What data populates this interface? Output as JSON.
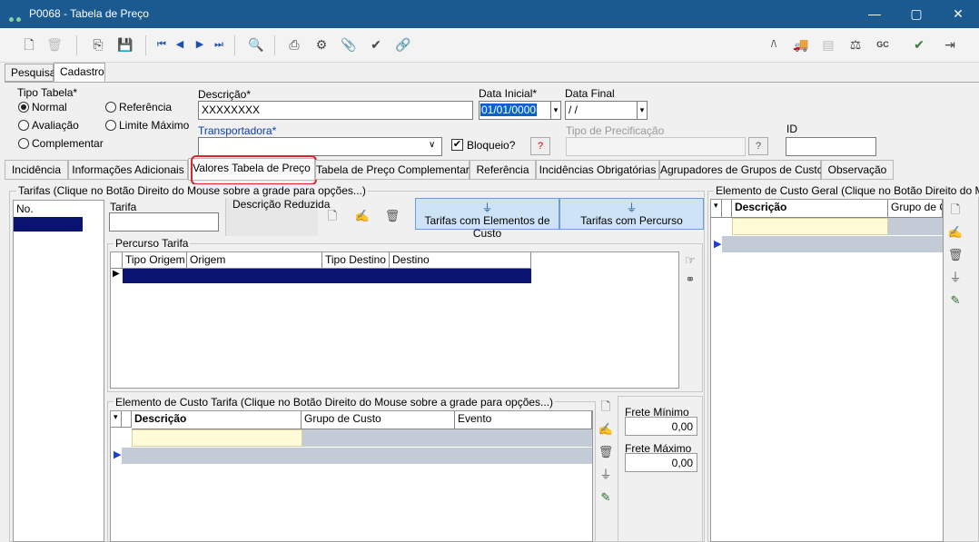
{
  "window": {
    "title": "P0068 - Tabela de Preço",
    "minimize": "—",
    "maximize": "▢",
    "close": "✕"
  },
  "toolbar": {
    "new": "🗋",
    "delete": "🗑",
    "copy": "⎘",
    "save": "💾",
    "first": "⏮",
    "prev": "◀",
    "next": "▶",
    "last": "⏭",
    "find": "🔍",
    "print": "⎙",
    "settings": "⚙",
    "attach": "📎",
    "confirm": "✔",
    "link": "🔗",
    "r1": "/\\",
    "r2": "🚚",
    "r3": "▤",
    "r4": "⚖",
    "r5": "GC",
    "r6": "✔",
    "r7": "⇥"
  },
  "tabs": {
    "pesquisa": "Pesquisa",
    "cadastro": "Cadastro"
  },
  "header": {
    "tipo_tabela_label": "Tipo Tabela*",
    "radio_normal": "Normal",
    "radio_avaliacao": "Avaliação",
    "radio_complementar": "Complementar",
    "radio_referencia": "Referência",
    "radio_limite": "Limite Máximo",
    "descricao_label": "Descrição*",
    "descricao_value": "XXXXXXXX",
    "data_inicial_label": "Data Inicial*",
    "data_inicial_value": "01/01/0000",
    "data_final_label": "Data Final",
    "data_final_value": " / /",
    "transportadora_label": "Transportadora*",
    "transportadora_value": "",
    "bloqueio_label": "Bloqueio?",
    "bloqueio_checked": "✔",
    "help": "?",
    "tipo_precificacao_label": "Tipo de Precificação",
    "id_label": "ID",
    "id_value": ""
  },
  "subtabs": [
    "Incidência",
    "Informações Adicionais",
    "Valores Tabela de Preço",
    "Tabela de Preço Complementar",
    "Referência",
    "Incidências Obrigatórias",
    "Agrupadores de Grupos de Custo",
    "Observação"
  ],
  "tarifas": {
    "group_label": "Tarifas    (Clique no Botão Direito do Mouse sobre a grade para opções...)",
    "col_no": "No.",
    "tarifa_label": "Tarifa",
    "tarifa_value": "",
    "desc_reduzida_label": "Descrição Reduzida",
    "btn_elementos": "Tarifas com Elementos de Custo",
    "btn_percurso": "Tarifas com Percurso"
  },
  "percurso": {
    "label": "Percurso Tarifa",
    "cols": [
      "Tipo Origem",
      "Origem",
      "Tipo Destino",
      "Destino"
    ]
  },
  "elemento_tarifa": {
    "label": "Elemento de Custo Tarifa   (Clique no Botão Direito do Mouse sobre a grade para opções...)",
    "cols": [
      "Descrição",
      "Grupo de Custo",
      "Evento"
    ]
  },
  "frete": {
    "min_label": "Frete Mínimo",
    "min_value": "0,00",
    "max_label": "Frete Máximo",
    "max_value": "0,00"
  },
  "elemento_geral": {
    "label": "Elemento de Custo Geral    (Clique no Botão Direito do Mouse",
    "cols": [
      "Descrição",
      "Grupo de Cu"
    ]
  },
  "icons": {
    "add": "🗋",
    "edit": "✍",
    "trash": "🗑",
    "filter": "⏚",
    "pen": "✎",
    "point": "☞",
    "binoc": "⚭",
    "marker": "▶",
    "sort": "▾"
  }
}
